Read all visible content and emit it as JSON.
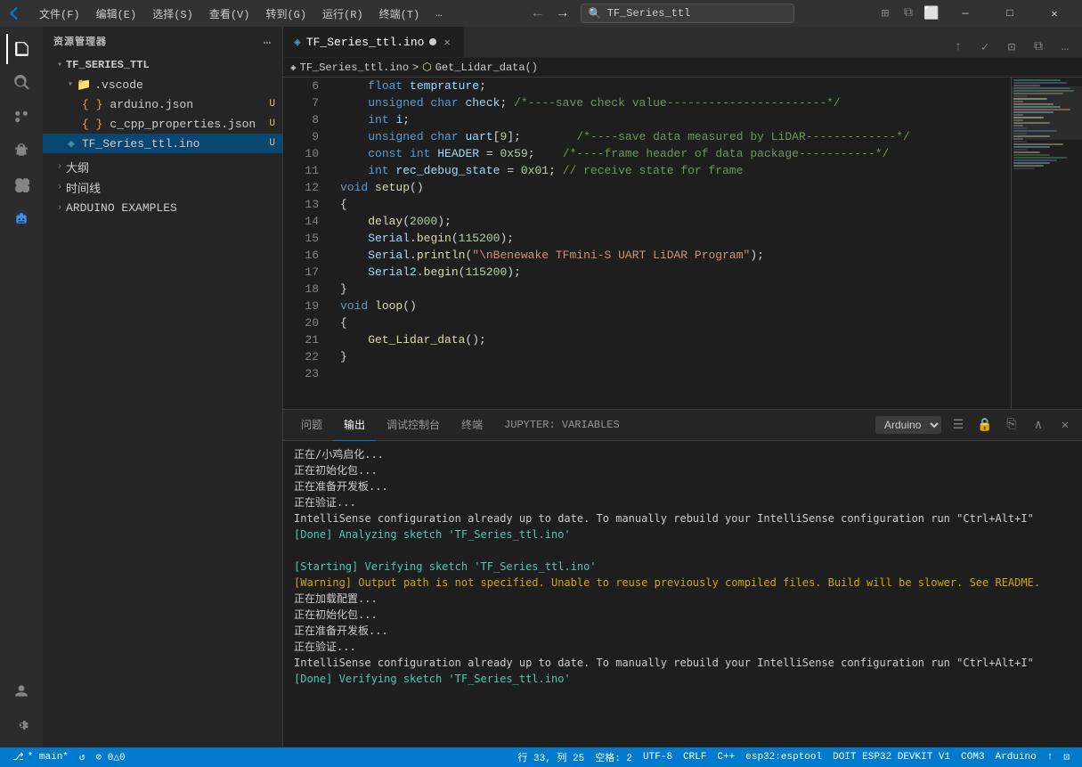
{
  "titleBar": {
    "appIcon": "vscode",
    "menus": [
      "文件(F)",
      "编辑(E)",
      "选择(S)",
      "查看(V)",
      "转到(G)",
      "运行(R)",
      "终端(T)",
      "…"
    ],
    "searchPlaceholder": "TF_Series_ttl",
    "navBack": "←",
    "navForward": "→",
    "windowButtons": {
      "minimize": "—",
      "maximize": "□",
      "close": "✕"
    }
  },
  "activityBar": {
    "icons": [
      "explorer",
      "search",
      "source-control",
      "debug",
      "extensions",
      "robot"
    ],
    "bottomIcons": [
      "account",
      "settings"
    ]
  },
  "sidebar": {
    "title": "资源管理器",
    "menuIcon": "…",
    "tree": [
      {
        "id": "root",
        "label": "TF_SERIES_TTL",
        "type": "folder",
        "indent": 0,
        "expanded": true
      },
      {
        "id": "vscode",
        "label": ".vscode",
        "type": "folder",
        "indent": 1,
        "expanded": true
      },
      {
        "id": "arduino-json",
        "label": "arduino.json",
        "type": "json",
        "indent": 2,
        "badge": "U"
      },
      {
        "id": "c-cpp-props",
        "label": "c_cpp_properties.json",
        "type": "json",
        "indent": 2,
        "badge": "U"
      },
      {
        "id": "tf-series",
        "label": "TF_Series_ttl.ino",
        "type": "ino",
        "indent": 1,
        "badge": "U",
        "active": true
      }
    ],
    "outline": {
      "label": "大纲",
      "expanded": false
    },
    "timeline": {
      "label": "时间线",
      "expanded": false
    },
    "arduinoExamples": {
      "label": "ARDUINO EXAMPLES",
      "expanded": false
    }
  },
  "editor": {
    "tabName": "TF_Series_ttl.ino",
    "tabModified": true,
    "breadcrumb": [
      "TF_Series_ttl.ino",
      ">",
      "Get_Lidar_data()"
    ],
    "lines": [
      {
        "num": 6,
        "tokens": [
          {
            "t": "    float temprature;",
            "c": "plain"
          }
        ]
      },
      {
        "num": 7,
        "tokens": [
          {
            "t": "    unsigned char check; ",
            "c": "plain"
          },
          {
            "t": "/*----save check value-----------------------*/",
            "c": "cmt"
          }
        ]
      },
      {
        "num": 8,
        "tokens": [
          {
            "t": "    int i;",
            "c": "plain"
          }
        ]
      },
      {
        "num": 9,
        "tokens": [
          {
            "t": "    unsigned char uart[9];",
            "c": "plain"
          },
          {
            "t": "        /*----save data measured by LiDAR-------------*/",
            "c": "cmt"
          }
        ]
      },
      {
        "num": 10,
        "tokens": [
          {
            "t": "    const int HEADER = 0x59;",
            "c": "plain"
          },
          {
            "t": "    /*----frame header of data package-----------*/",
            "c": "cmt"
          }
        ]
      },
      {
        "num": 11,
        "tokens": [
          {
            "t": "    int rec_debug_state = 0x01; // receive state for frame",
            "c": "plain"
          }
        ]
      },
      {
        "num": 12,
        "tokens": [
          {
            "t": "",
            "c": "plain"
          }
        ]
      },
      {
        "num": 13,
        "tokens": [
          {
            "t": "void setup()",
            "c": "plain"
          }
        ]
      },
      {
        "num": 14,
        "tokens": [
          {
            "t": "{",
            "c": "plain"
          }
        ]
      },
      {
        "num": 15,
        "tokens": [
          {
            "t": "    delay(2000);",
            "c": "plain"
          }
        ]
      },
      {
        "num": 16,
        "tokens": [
          {
            "t": "    Serial.begin(115200);",
            "c": "plain"
          }
        ]
      },
      {
        "num": 17,
        "tokens": [
          {
            "t": "    Serial.println(",
            "c": "plain"
          },
          {
            "t": "\"\\nBenewake TFmini-S UART LiDAR Program\"",
            "c": "str"
          },
          {
            "t": ");",
            "c": "plain"
          }
        ]
      },
      {
        "num": 18,
        "tokens": [
          {
            "t": "    Serial2.begin(115200);",
            "c": "plain"
          }
        ]
      },
      {
        "num": 19,
        "tokens": [
          {
            "t": "}",
            "c": "plain"
          }
        ]
      },
      {
        "num": 20,
        "tokens": [
          {
            "t": "void loop()",
            "c": "plain"
          }
        ]
      },
      {
        "num": 21,
        "tokens": [
          {
            "t": "{",
            "c": "plain"
          }
        ]
      },
      {
        "num": 22,
        "tokens": [
          {
            "t": "    Get_Lidar_data();",
            "c": "plain"
          }
        ]
      },
      {
        "num": 23,
        "tokens": [
          {
            "t": "}",
            "c": "plain"
          }
        ]
      }
    ]
  },
  "panel": {
    "tabs": [
      "问题",
      "输出",
      "调试控制台",
      "终端",
      "JUPYTER: VARIABLES"
    ],
    "activeTab": "输出",
    "dropdownOptions": [
      "Arduino"
    ],
    "dropdownSelected": "Arduino",
    "output": [
      {
        "text": "正在/小鸡启化...",
        "style": "normal"
      },
      {
        "text": "正在初始化包...",
        "style": "normal"
      },
      {
        "text": "正在准备开发板...",
        "style": "normal"
      },
      {
        "text": "正在验证...",
        "style": "normal"
      },
      {
        "text": "IntelliSense configuration already up to date. To manually rebuild your IntelliSense configuration run \"Ctrl+Alt+I\"",
        "style": "normal"
      },
      {
        "text": "[Done] Analyzing sketch 'TF_Series_ttl.ino'",
        "style": "done"
      },
      {
        "text": "",
        "style": "normal"
      },
      {
        "text": "[Starting] Verifying sketch 'TF_Series_ttl.ino'",
        "style": "done"
      },
      {
        "text": "[Warning] Output path is not specified. Unable to reuse previously compiled files. Build will be slower. See README.",
        "style": "warning"
      },
      {
        "text": "正在加载配置...",
        "style": "normal"
      },
      {
        "text": "正在初始化包...",
        "style": "normal"
      },
      {
        "text": "正在准备开发板...",
        "style": "normal"
      },
      {
        "text": "正在验证...",
        "style": "normal"
      },
      {
        "text": "IntelliSense configuration already up to date. To manually rebuild your IntelliSense configuration run \"Ctrl+Alt+I\"",
        "style": "normal"
      },
      {
        "text": "[Done] Verifying sketch 'TF_Series_ttl.ino'",
        "style": "done"
      }
    ]
  },
  "statusBar": {
    "branch": "* main*",
    "sync": "↺",
    "errors": "⊘ 0△0",
    "line": "行 33, 列 25",
    "spaces": "空格: 2",
    "encoding": "UTF-8",
    "lineEnding": "CRLF",
    "language": "C++",
    "board": "esp32:esptool",
    "boardName": "DOIT ESP32 DEVKIT V1",
    "port": "COM3",
    "platform": "Arduino",
    "uploadIcon": "↑",
    "serialIcon": "⊡"
  }
}
